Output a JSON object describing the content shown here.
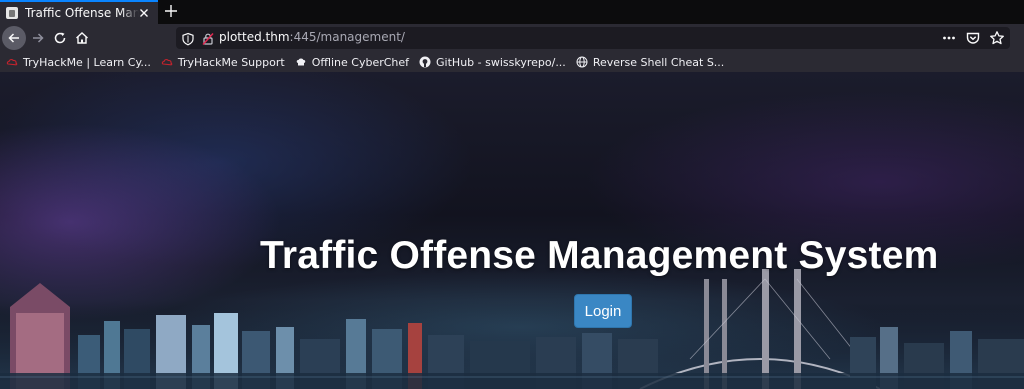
{
  "browser": {
    "tab": {
      "title": "Traffic Offense Management System",
      "close_icon": "close-icon",
      "favicon": "page-icon"
    },
    "new_tab_icon": "plus-icon",
    "nav": {
      "back_icon": "arrow-left-icon",
      "forward_icon": "arrow-right-icon",
      "reload_icon": "reload-icon",
      "home_icon": "home-icon"
    },
    "url": {
      "host": "plotted.thm",
      "rest": ":445/management/"
    },
    "url_actions": [
      "more-icon",
      "pocket-icon",
      "star-icon"
    ],
    "bookmarks": [
      {
        "label": "TryHackMe | Learn Cy...",
        "icon": "tryhackme-icon"
      },
      {
        "label": "TryHackMe Support",
        "icon": "tryhackme-icon"
      },
      {
        "label": "Offline CyberChef",
        "icon": "chef-hat-icon"
      },
      {
        "label": "GitHub - swisskyrepo/...",
        "icon": "github-icon"
      },
      {
        "label": "Reverse Shell Cheat S...",
        "icon": "globe-icon"
      }
    ]
  },
  "page": {
    "title": "Traffic Offense Management System",
    "login_label": "Login",
    "accent": "#3a87c4"
  }
}
